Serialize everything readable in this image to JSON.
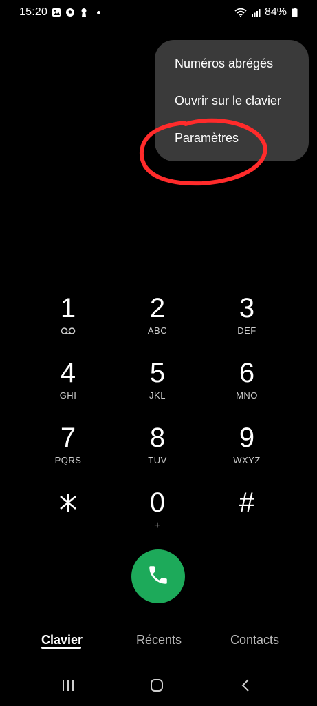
{
  "status_bar": {
    "time": "15:20",
    "battery_text": "84%",
    "icons_left": [
      "gallery-icon",
      "soccer-ball-icon",
      "keyhole-icon",
      "notification-dot"
    ],
    "icons_right": [
      "wifi-icon",
      "signal-icon",
      "battery-icon"
    ]
  },
  "menu": {
    "items": [
      {
        "label": "Numéros abrégés"
      },
      {
        "label": "Ouvrir sur le clavier"
      },
      {
        "label": "Paramètres"
      }
    ],
    "background": "#3a3a3a"
  },
  "annotation": {
    "color": "#ff2b2b",
    "shape": "hand-drawn-circle"
  },
  "keypad": {
    "keys": [
      {
        "digit": "1",
        "letters": "",
        "sub_icon": "voicemail-icon"
      },
      {
        "digit": "2",
        "letters": "ABC"
      },
      {
        "digit": "3",
        "letters": "DEF"
      },
      {
        "digit": "4",
        "letters": "GHI"
      },
      {
        "digit": "5",
        "letters": "JKL"
      },
      {
        "digit": "6",
        "letters": "MNO"
      },
      {
        "digit": "7",
        "letters": "PQRS"
      },
      {
        "digit": "8",
        "letters": "TUV"
      },
      {
        "digit": "9",
        "letters": "WXYZ"
      },
      {
        "digit": "*",
        "letters": "",
        "icon": "asterisk-icon"
      },
      {
        "digit": "0",
        "letters": "+"
      },
      {
        "digit": "#",
        "letters": ""
      }
    ]
  },
  "call_button": {
    "icon": "phone-icon",
    "color": "#1daa5a"
  },
  "tabs": [
    {
      "label": "Clavier",
      "active": true
    },
    {
      "label": "Récents",
      "active": false
    },
    {
      "label": "Contacts",
      "active": false
    }
  ],
  "navbar": {
    "icons": [
      "recent-apps-icon",
      "home-icon",
      "back-icon"
    ]
  }
}
